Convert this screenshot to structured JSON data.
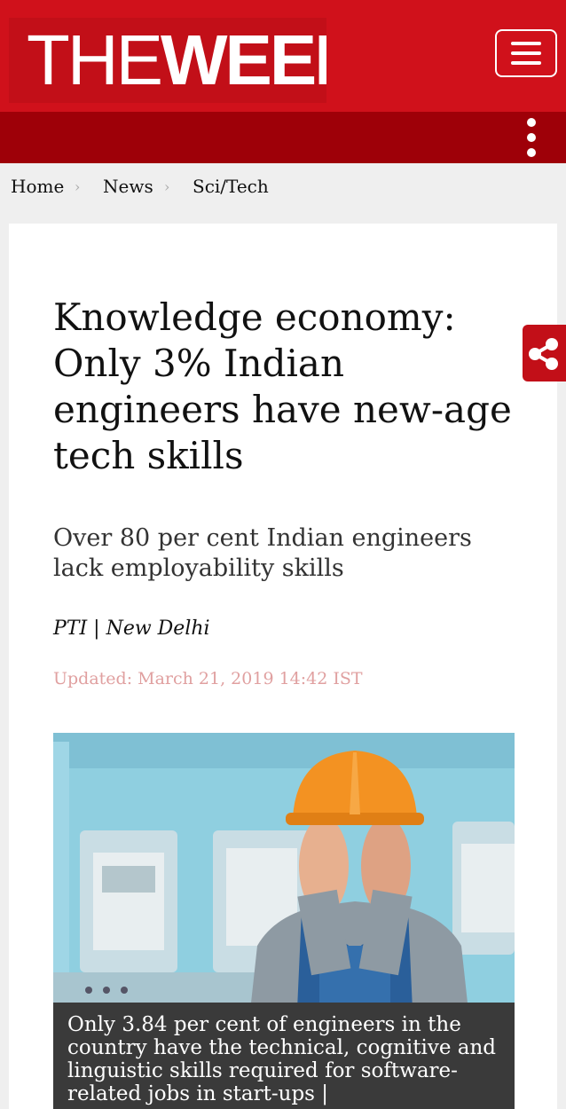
{
  "header": {
    "logo_the": "THE",
    "logo_week": "WEEK"
  },
  "breadcrumb": {
    "items": [
      "Home",
      "News",
      "Sci/Tech"
    ]
  },
  "article": {
    "headline": "Knowledge economy: Only 3% Indian engineers have new-age tech skills",
    "subhead": "Over 80 per cent Indian engineers lack employability skills",
    "byline": "PTI | New Delhi",
    "updated": "Updated: March 21, 2019 14:42 IST",
    "caption": "Only 3.84 per cent of engineers in the country have the technical, cognitive and linguistic skills required for software-related jobs in start-ups |"
  },
  "colors": {
    "brand_red": "#d0111b",
    "brand_dark_red": "#9e0008",
    "updated_text": "#e0a0a0"
  },
  "icons": {
    "menu": "hamburger-menu-icon",
    "more": "more-vertical-icon",
    "share": "share-icon",
    "chevron": "chevron-right-icon"
  }
}
